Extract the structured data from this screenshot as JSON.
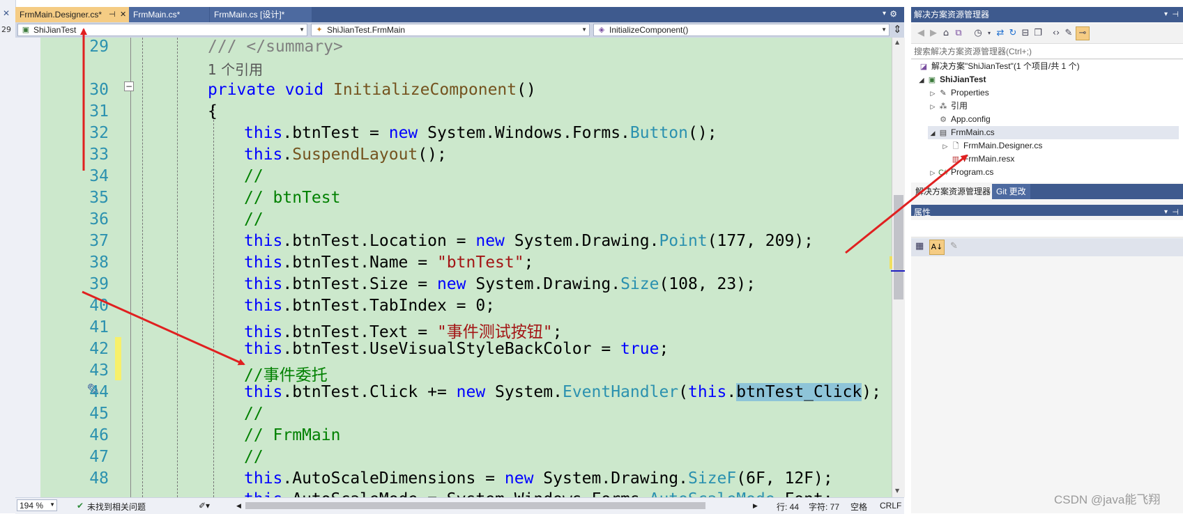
{
  "tabs": [
    {
      "label": "FrmMain.Designer.cs*",
      "pin": "⊣",
      "close": "✕"
    },
    {
      "label": "FrmMain.cs*"
    },
    {
      "label": "FrmMain.cs [设计]*"
    }
  ],
  "left_strip": {
    "close": "✕",
    "num": "29"
  },
  "navbar": {
    "project": "ShiJianTest",
    "class": "ShiJianTest.FrmMain",
    "member": "InitializeComponent()"
  },
  "editor": {
    "line_numbers": [
      "29",
      "",
      "30",
      "31",
      "32",
      "33",
      "34",
      "35",
      "36",
      "37",
      "38",
      "39",
      "40",
      "41",
      "42",
      "43",
      "44",
      "45",
      "46",
      "47",
      "48"
    ],
    "codelens": "1 个引用",
    "lines": {
      "l29": "/// </summary>",
      "l30_kw": "private void",
      "l30_name": "InitializeComponent",
      "l30_end": "()",
      "l31": "{",
      "this": "this",
      "new": "new",
      "true": "true",
      "l32_a": ".btnTest = ",
      "l32_b": " System.Windows.Forms.",
      "l32_t": "Button",
      "l32_c": "();",
      "l33_m": "SuspendLayout",
      "l33_c": "();",
      "l34": "//",
      "l35": "// btnTest",
      "l36": "//",
      "l37_a": ".btnTest.Location = ",
      "l37_b": " System.Drawing.",
      "l37_t": "Point",
      "l37_c": "(177, 209);",
      "l38_a": ".btnTest.Name = ",
      "l38_s": "\"btnTest\"",
      "l38_c": ";",
      "l39_a": ".btnTest.Size = ",
      "l39_b": " System.Drawing.",
      "l39_t": "Size",
      "l39_c": "(108, 23);",
      "l40_a": ".btnTest.TabIndex = 0;",
      "l41_a": ".btnTest.Text = ",
      "l41_s": "\"事件测试按钮\"",
      "l41_c": ";",
      "l42_a": ".btnTest.UseVisualStyleBackColor = ",
      "l42_c": ";",
      "l43": "//事件委托",
      "l44_a": ".btnTest.Click += ",
      "l44_b": " System.",
      "l44_t": "EventHandler",
      "l44_p": "(",
      "l44_hl": "btnTest_Click",
      "l44_c": ");",
      "l45": "//",
      "l46": "// FrmMain",
      "l47": "//",
      "l48_a": ".AutoScaleDimensions = ",
      "l48_b": " System.Drawing.",
      "l48_t": "SizeF",
      "l48_c": "(6F, 12F);",
      "l49_a": ".AutoScaleMode = System.Windows.Forms.",
      "l49_t": "AutoScaleMode",
      "l49_c": ".Font;"
    }
  },
  "statusbar": {
    "zoom": "194 %",
    "issues": "未找到相关问题",
    "line": "行: 44",
    "col": "字符: 77",
    "mode": "空格",
    "eol": "CRLF"
  },
  "solution_explorer": {
    "title": "解决方案资源管理器",
    "search_placeholder": "搜索解决方案资源管理器(Ctrl+;)",
    "items": [
      {
        "label": "解决方案\"ShiJianTest\"(1 个项目/共 1 个)"
      },
      {
        "label": "ShiJianTest"
      },
      {
        "label": "Properties"
      },
      {
        "label": "引用"
      },
      {
        "label": "App.config"
      },
      {
        "label": "FrmMain.cs"
      },
      {
        "label": "FrmMain.Designer.cs"
      },
      {
        "label": "FrmMain.resx"
      },
      {
        "label": "Program.cs"
      }
    ],
    "bottom_tabs": [
      "解决方案资源管理器",
      "Git 更改"
    ]
  },
  "properties": {
    "title": "属性"
  },
  "watermark": "CSDN @java能飞翔",
  "colors": {
    "accent": "#3e5a8e",
    "active_tab": "#f5cc84",
    "editor_bg": "#cce8cc",
    "arrow": "#e02020"
  }
}
